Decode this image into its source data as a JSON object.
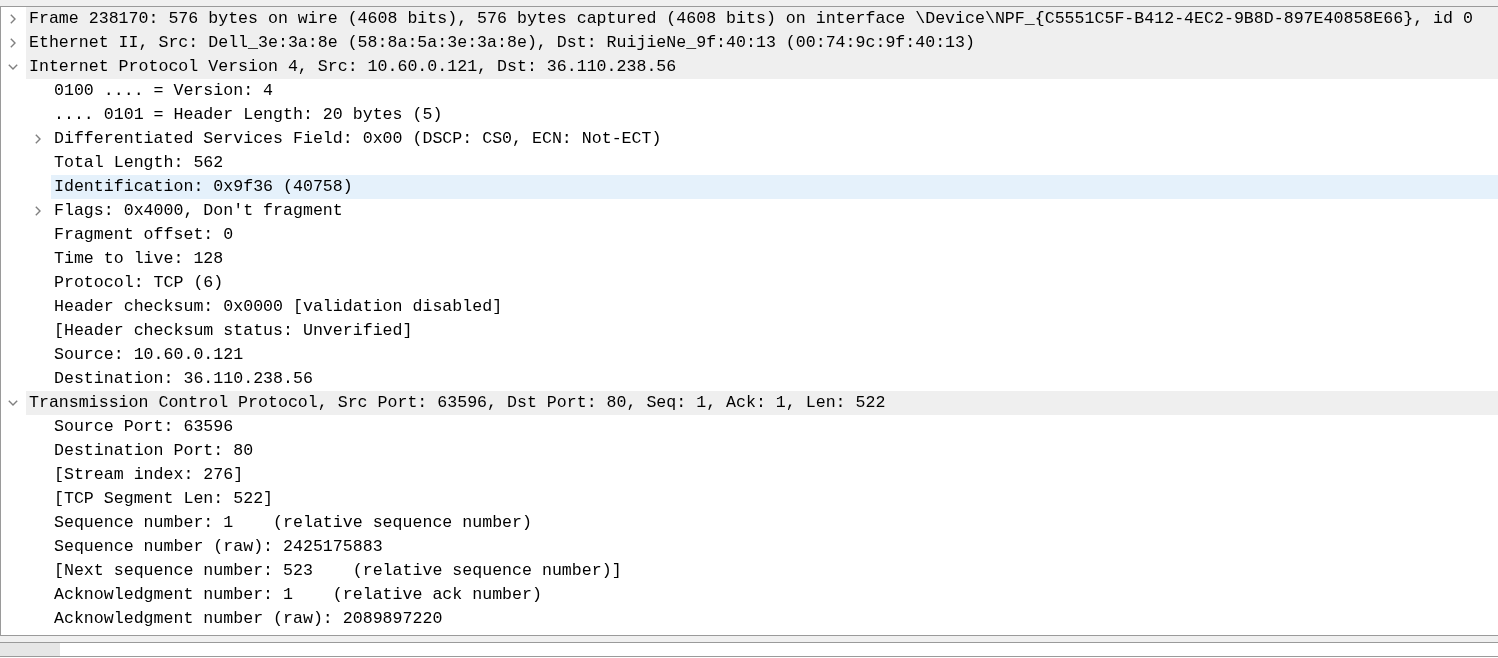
{
  "packet_details": {
    "items": [
      {
        "kind": "branch",
        "text": "Frame 238170: 576 bytes on wire (4608 bits), 576 bytes captured (4608 bits) on interface \\Device\\NPF_{C5551C5F-B412-4EC2-9B8D-897E40858E66}, id 0",
        "expanded": false,
        "selected": false
      },
      {
        "kind": "branch",
        "text": "Ethernet II, Src: Dell_3e:3a:8e (58:8a:5a:3e:3a:8e), Dst: RuijieNe_9f:40:13 (00:74:9c:9f:40:13)",
        "expanded": false,
        "selected": false
      },
      {
        "kind": "branch",
        "text": "Internet Protocol Version 4, Src: 10.60.0.121, Dst: 36.110.238.56",
        "expanded": true,
        "selected": false,
        "children": [
          {
            "kind": "leaf",
            "text": "0100 .... = Version: 4",
            "selected": false
          },
          {
            "kind": "leaf",
            "text": ".... 0101 = Header Length: 20 bytes (5)",
            "selected": false
          },
          {
            "kind": "branch",
            "text": "Differentiated Services Field: 0x00 (DSCP: CS0, ECN: Not-ECT)",
            "expanded": false,
            "selected": false
          },
          {
            "kind": "leaf",
            "text": "Total Length: 562",
            "selected": false
          },
          {
            "kind": "leaf",
            "text": "Identification: 0x9f36 (40758)",
            "selected": true
          },
          {
            "kind": "branch",
            "text": "Flags: 0x4000, Don't fragment",
            "expanded": false,
            "selected": false
          },
          {
            "kind": "leaf",
            "text": "Fragment offset: 0",
            "selected": false
          },
          {
            "kind": "leaf",
            "text": "Time to live: 128",
            "selected": false
          },
          {
            "kind": "leaf",
            "text": "Protocol: TCP (6)",
            "selected": false
          },
          {
            "kind": "leaf",
            "text": "Header checksum: 0x0000 [validation disabled]",
            "selected": false
          },
          {
            "kind": "leaf",
            "text": "[Header checksum status: Unverified]",
            "selected": false
          },
          {
            "kind": "leaf",
            "text": "Source: 10.60.0.121",
            "selected": false
          },
          {
            "kind": "leaf",
            "text": "Destination: 36.110.238.56",
            "selected": false
          }
        ]
      },
      {
        "kind": "branch",
        "text": "Transmission Control Protocol, Src Port: 63596, Dst Port: 80, Seq: 1, Ack: 1, Len: 522",
        "expanded": true,
        "selected": false,
        "children": [
          {
            "kind": "leaf",
            "text": "Source Port: 63596",
            "selected": false
          },
          {
            "kind": "leaf",
            "text": "Destination Port: 80",
            "selected": false
          },
          {
            "kind": "leaf",
            "text": "[Stream index: 276]",
            "selected": false
          },
          {
            "kind": "leaf",
            "text": "[TCP Segment Len: 522]",
            "selected": false
          },
          {
            "kind": "leaf",
            "text": "Sequence number: 1    (relative sequence number)",
            "selected": false
          },
          {
            "kind": "leaf",
            "text": "Sequence number (raw): 2425175883",
            "selected": false
          },
          {
            "kind": "leaf",
            "text": "[Next sequence number: 523    (relative sequence number)]",
            "selected": false
          },
          {
            "kind": "leaf",
            "text": "Acknowledgment number: 1    (relative ack number)",
            "selected": false
          },
          {
            "kind": "leaf",
            "text": "Acknowledgment number (raw): 2089897220",
            "selected": false
          }
        ]
      }
    ]
  }
}
